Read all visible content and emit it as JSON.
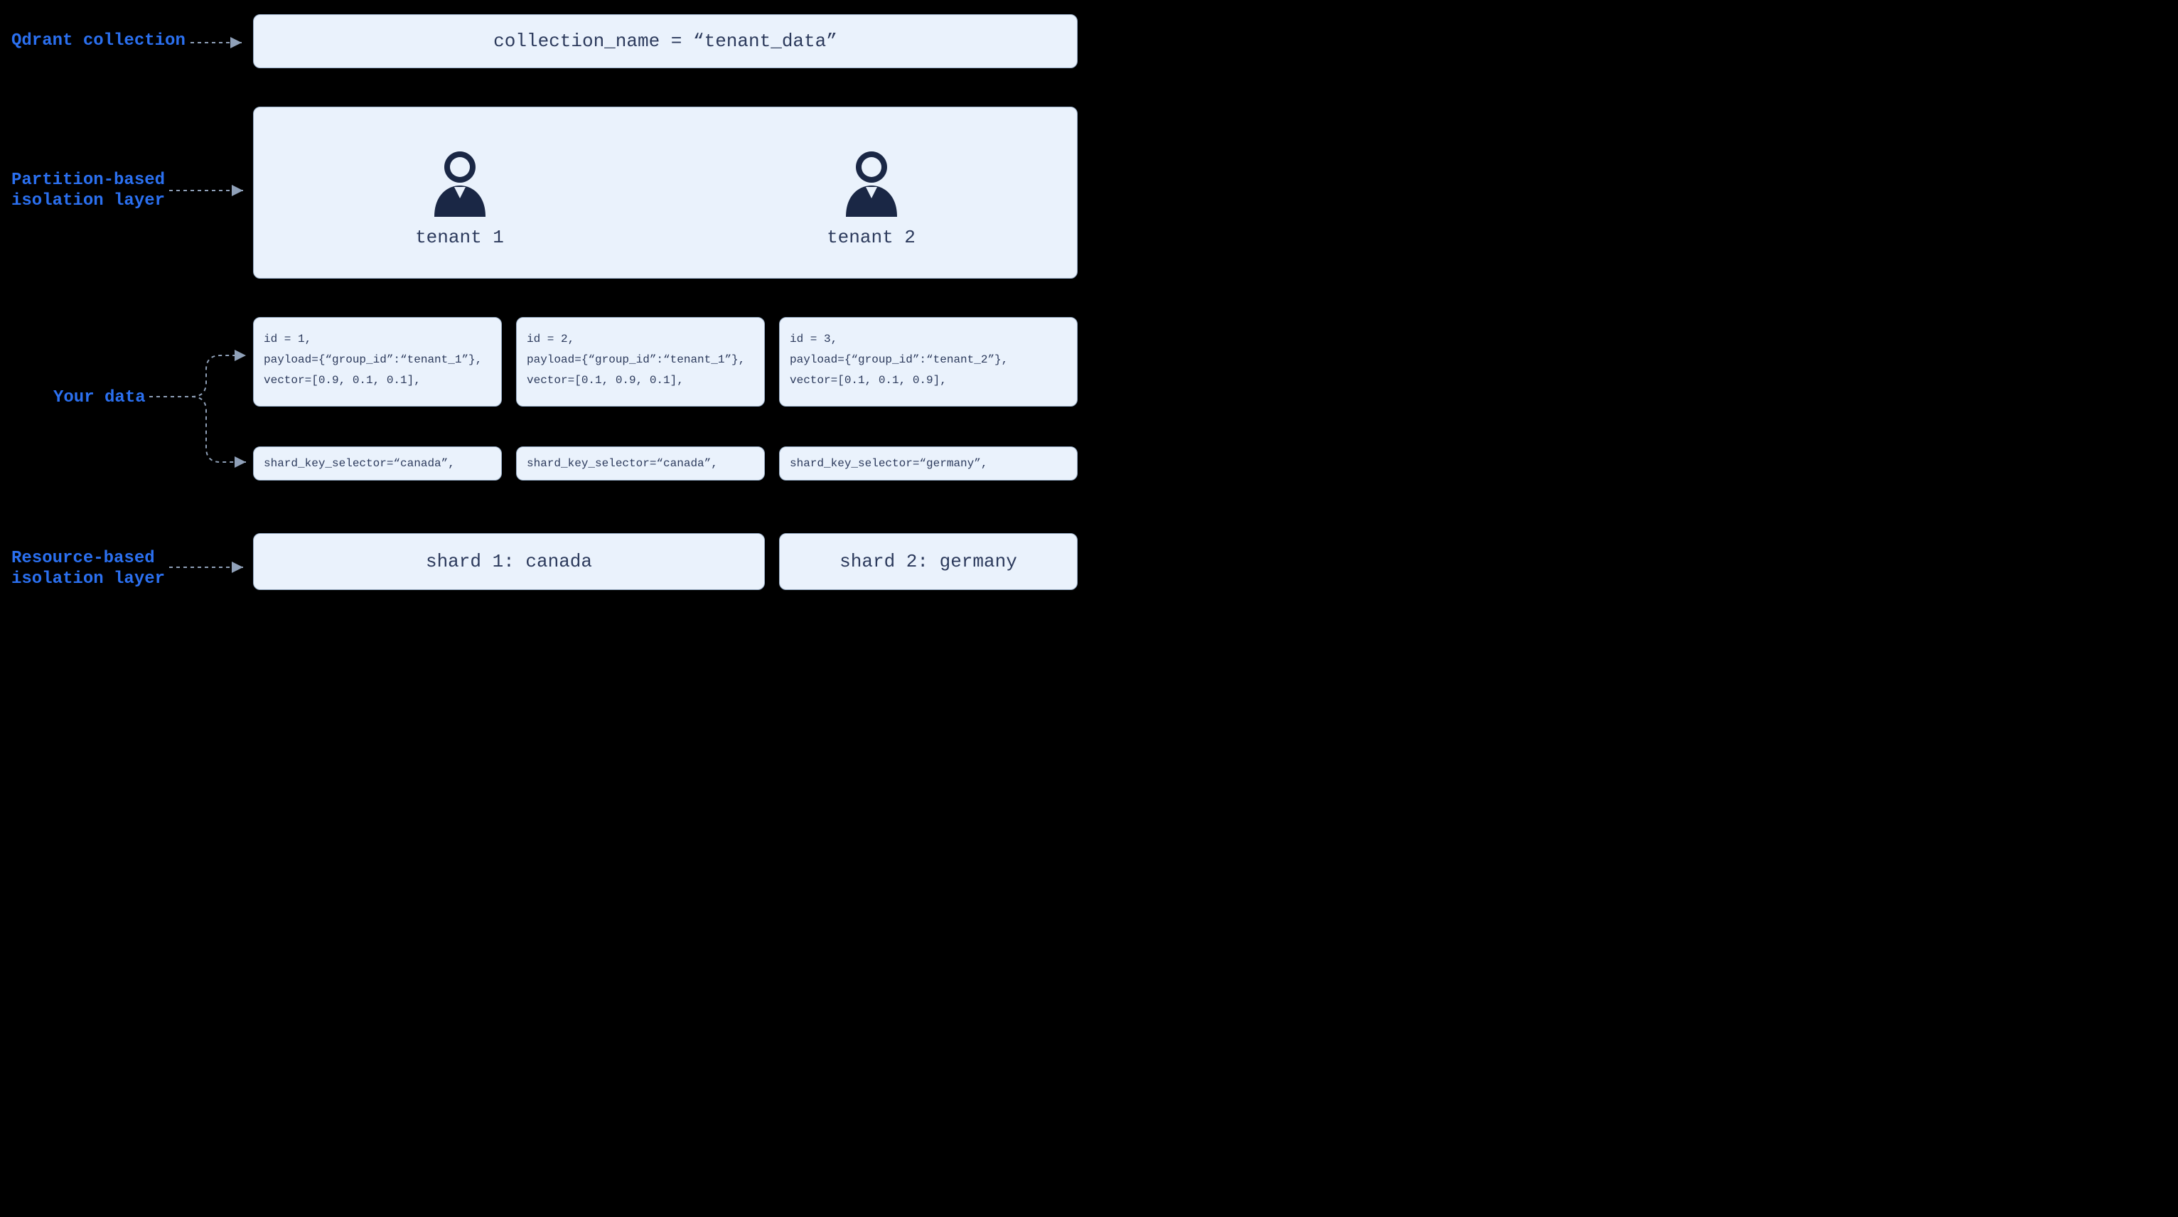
{
  "labels": {
    "collection": "Qdrant collection",
    "partition": "Partition-based\nisolation layer",
    "your_data": "Your data",
    "resource": "Resource-based\nisolation layer"
  },
  "collection_box": "collection_name = “tenant_data”",
  "tenants": [
    "tenant 1",
    "tenant 2"
  ],
  "data_points": [
    {
      "id": "id = 1,",
      "payload": "payload={“group_id”:“tenant_1”},",
      "vector": "vector=[0.9, 0.1, 0.1],"
    },
    {
      "id": "id = 2,",
      "payload": "payload={“group_id”:“tenant_1”},",
      "vector": "vector=[0.1, 0.9, 0.1],"
    },
    {
      "id": "id = 3,",
      "payload": "payload={“group_id”:“tenant_2”},",
      "vector": "vector=[0.1, 0.1, 0.9],"
    }
  ],
  "shard_selectors": [
    "shard_key_selector=“canada”,",
    "shard_key_selector=“canada”,",
    "shard_key_selector=“germany”,"
  ],
  "shards": [
    "shard 1: canada",
    "shard 2: germany"
  ]
}
